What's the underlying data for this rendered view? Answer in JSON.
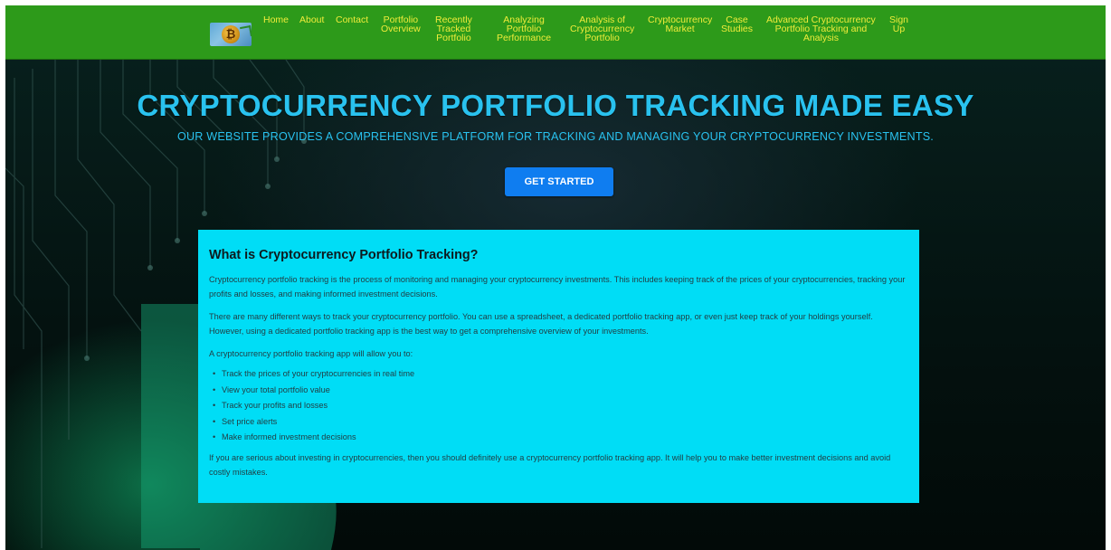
{
  "nav": {
    "items": [
      {
        "lines": [
          "Home"
        ]
      },
      {
        "lines": [
          "About"
        ]
      },
      {
        "lines": [
          "Contact"
        ]
      },
      {
        "lines": [
          "Portfolio",
          "Overview"
        ]
      },
      {
        "lines": [
          "Recently",
          "Tracked",
          "Portfolio"
        ]
      },
      {
        "lines": [
          "Analyzing",
          "Portfolio",
          "Performance"
        ]
      },
      {
        "lines": [
          "Analysis of",
          "Cryptocurrency",
          "Portfolio"
        ]
      },
      {
        "lines": [
          "Cryptocurrency",
          "Market"
        ]
      },
      {
        "lines": [
          "Case",
          "Studies"
        ]
      },
      {
        "lines": [
          "Advanced Cryptocurrency",
          "Portfolio Tracking and",
          "Analysis"
        ]
      },
      {
        "lines": [
          "Sign",
          "Up"
        ]
      }
    ]
  },
  "hero": {
    "title": "CRYPTOCURRENCY PORTFOLIO TRACKING MADE EASY",
    "subtitle": "OUR WEBSITE PROVIDES A COMPREHENSIVE PLATFORM FOR TRACKING AND MANAGING YOUR CRYPTOCURRENCY INVESTMENTS.",
    "cta_label": "GET STARTED"
  },
  "content": {
    "heading": "What is Cryptocurrency Portfolio Tracking?",
    "para1": "Cryptocurrency portfolio tracking is the process of monitoring and managing your cryptocurrency investments. This includes keeping track of the prices of your cryptocurrencies, tracking your profits and losses, and making informed investment decisions.",
    "para2": "There are many different ways to track your cryptocurrency portfolio. You can use a spreadsheet, a dedicated portfolio tracking app, or even just keep track of your holdings yourself. However, using a dedicated portfolio tracking app is the best way to get a comprehensive overview of your investments.",
    "para3": "A cryptocurrency portfolio tracking app will allow you to:",
    "list": [
      "Track the prices of your cryptocurrencies in real time",
      "View your total portfolio value",
      "Track your profits and losses",
      "Set price alerts",
      "Make informed investment decisions"
    ],
    "para4": "If you are serious about investing in cryptocurrencies, then you should definitely use a cryptocurrency portfolio tracking app. It will help you to make better investment decisions and avoid costly mistakes."
  },
  "colors": {
    "nav_bg": "#2d9a1a",
    "nav_link": "#f0ec3a",
    "hero_text": "#29c2ef",
    "cta_bg": "#0f7df0",
    "card_bg": "#00ddf6"
  },
  "icons": {
    "logo": "bitcoin-coin-logo-icon"
  }
}
